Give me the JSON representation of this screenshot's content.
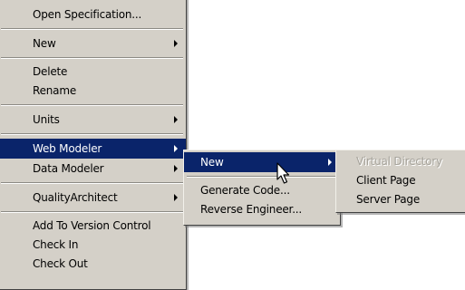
{
  "main_menu": {
    "open_specification": "Open Specification...",
    "new": "New",
    "delete": "Delete",
    "rename": "Rename",
    "units": "Units",
    "web_modeler": "Web Modeler",
    "data_modeler": "Data Modeler",
    "quality_architect": "QualityArchitect",
    "add_to_version_control": "Add To Version Control",
    "check_in": "Check In",
    "check_out": "Check Out"
  },
  "web_modeler_menu": {
    "new": "New",
    "generate_code": "Generate Code...",
    "reverse_engineer": "Reverse Engineer..."
  },
  "new_submenu": {
    "virtual_directory": "Virtual Directory",
    "client_page": "Client Page",
    "server_page": "Server Page"
  },
  "colors": {
    "menu_background": "#d4d0c8",
    "highlight": "#0a246a",
    "highlight_text": "#ffffff",
    "disabled_text": "#a6a39b"
  },
  "icons": {
    "submenu_arrow": "right-triangle",
    "cursor": "arrow-pointer"
  }
}
